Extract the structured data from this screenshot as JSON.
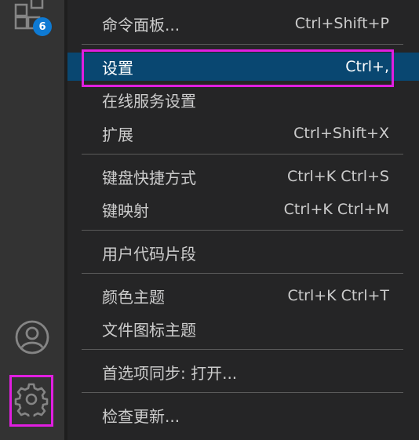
{
  "activity_bar": {
    "extensions_badge": "6",
    "icons": [
      "extensions-icon",
      "account-icon",
      "gear-icon"
    ]
  },
  "menu": {
    "items": [
      {
        "label": "命令面板...",
        "shortcut": "Ctrl+Shift+P"
      },
      {
        "label": "设置",
        "shortcut": "Ctrl+,"
      },
      {
        "label": "在线服务设置",
        "shortcut": ""
      },
      {
        "label": "扩展",
        "shortcut": "Ctrl+Shift+X"
      },
      {
        "label": "键盘快捷方式",
        "shortcut": "Ctrl+K Ctrl+S"
      },
      {
        "label": "键映射",
        "shortcut": "Ctrl+K Ctrl+M"
      },
      {
        "label": "用户代码片段",
        "shortcut": ""
      },
      {
        "label": "颜色主题",
        "shortcut": "Ctrl+K Ctrl+T"
      },
      {
        "label": "文件图标主题",
        "shortcut": ""
      },
      {
        "label": "首选项同步: 打开...",
        "shortcut": ""
      },
      {
        "label": "检查更新...",
        "shortcut": ""
      }
    ]
  },
  "colors": {
    "highlight": "#e01ee0",
    "selected_bg": "#094771",
    "badge": "#0e7ad3"
  }
}
